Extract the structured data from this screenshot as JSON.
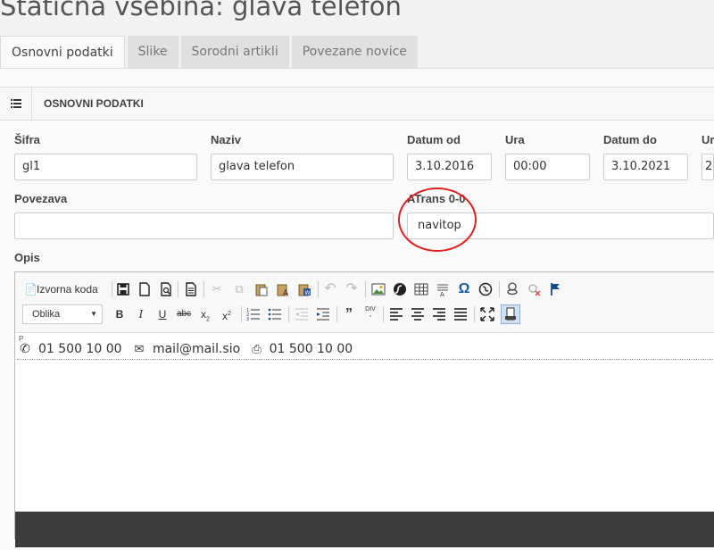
{
  "page": {
    "title": "Statična vsebina: glava telefon"
  },
  "tabs": [
    {
      "label": "Osnovni podatki",
      "active": true
    },
    {
      "label": "Slike"
    },
    {
      "label": "Sorodni artikli"
    },
    {
      "label": "Povezane novice"
    }
  ],
  "panel": {
    "title": "OSNOVNI PODATKI",
    "icon": "list-icon"
  },
  "form": {
    "sifra": {
      "label": "Šifra",
      "value": "gl1"
    },
    "naziv": {
      "label": "Naziv",
      "value": "glava telefon"
    },
    "datum_od": {
      "label": "Datum od",
      "value": "3.10.2016"
    },
    "ura_od": {
      "label": "Ura",
      "value": "00:00"
    },
    "datum_do": {
      "label": "Datum do",
      "value": "3.10.2021"
    },
    "ura_do": {
      "label": "Ur",
      "value": "2"
    },
    "povezava": {
      "label": "Povezava",
      "value": ""
    },
    "atrans": {
      "label": "ATrans 0-0",
      "value": "navitop"
    },
    "opis": {
      "label": "Opis"
    }
  },
  "editor": {
    "source_label": "Izvorna koda",
    "format_combo": "Oblika",
    "path_tag": "P",
    "content": {
      "phone1": "01 500 10 00",
      "email": "mail@mail.sio",
      "phone2": "01 500 10 00"
    }
  },
  "colors": {
    "highlight_circle": "#e02020",
    "status_bar": "#3c3c3c"
  }
}
